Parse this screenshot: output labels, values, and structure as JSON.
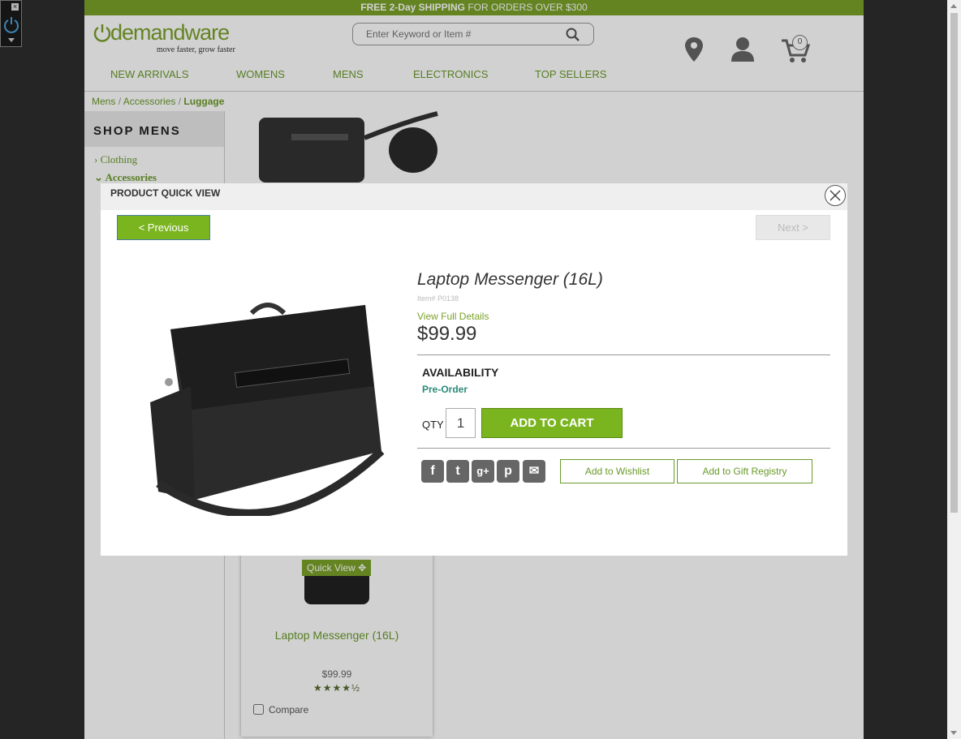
{
  "promo": {
    "bold": "FREE 2-Day SHIPPING",
    "rest": " FOR ORDERS OVER $300"
  },
  "logo": {
    "word": "demandware",
    "tagline": "move faster, grow faster"
  },
  "search": {
    "placeholder": "Enter Keyword or Item #"
  },
  "cart": {
    "count": "0"
  },
  "nav": [
    "NEW ARRIVALS",
    "WOMENS",
    "MENS",
    "ELECTRONICS",
    "TOP SELLERS"
  ],
  "breadcrumb": {
    "level1": "Mens",
    "level2": "Accessories",
    "current": "Luggage",
    "sep": "/"
  },
  "sidebar": {
    "heading": "SHOP MENS",
    "items": [
      "Clothing",
      "Accessories"
    ]
  },
  "tile": {
    "quick_view": "Quick View",
    "name": "Laptop Messenger (16L)",
    "price": "$99.99",
    "rating": 4.5,
    "compare": "Compare"
  },
  "modal": {
    "title": "PRODUCT QUICK VIEW",
    "prev_label": "< Previous",
    "next_label": "Next >",
    "product_name": "Laptop Messenger (16L)",
    "item_number": "Item# P0138",
    "view_details": "View Full Details",
    "price": "$99.99",
    "availability_heading": "AVAILABILITY",
    "availability_value": "Pre-Order",
    "qty_label": "QTY",
    "qty_value": "1",
    "add_to_cart": "ADD TO CART",
    "share_icons": [
      "facebook-icon",
      "twitter-icon",
      "google-plus-icon",
      "pinterest-icon",
      "email-icon"
    ],
    "wishlist_label": "Add to Wishlist",
    "gift_label": "Add to Gift Registry"
  },
  "colors": {
    "brand_green": "#7ba12a",
    "button_green": "#7ab520",
    "avail_teal": "#2a8a7a"
  }
}
